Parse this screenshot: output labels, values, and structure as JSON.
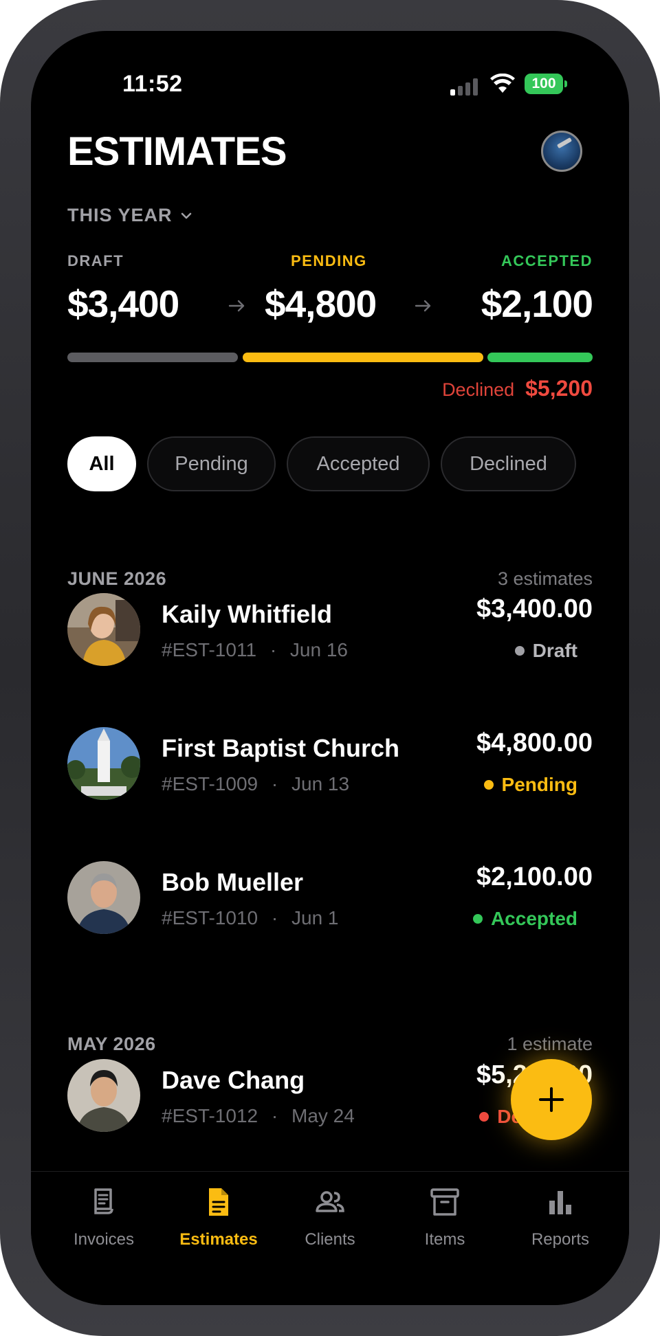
{
  "status_bar": {
    "time": "11:52",
    "battery": "100"
  },
  "header": {
    "title": "ESTIMATES",
    "period": "THIS YEAR"
  },
  "summary": {
    "draft": {
      "label": "DRAFT",
      "value": "$3,400"
    },
    "pending": {
      "label": "PENDING",
      "value": "$4,800"
    },
    "accepted": {
      "label": "ACCEPTED",
      "value": "$2,100"
    },
    "declined_label": "Declined",
    "declined_value": "$5,200"
  },
  "filters": [
    {
      "label": "All",
      "active": true
    },
    {
      "label": "Pending",
      "active": false
    },
    {
      "label": "Accepted",
      "active": false
    },
    {
      "label": "Declined",
      "active": false
    }
  ],
  "groups": [
    {
      "title": "JUNE 2026",
      "count": "3 estimates",
      "rows": [
        {
          "name": "Kaily Whitfield",
          "number": "#EST-1011",
          "date": "Jun 16",
          "amount": "$3,400.00",
          "status": "Draft"
        },
        {
          "name": "First Baptist Church",
          "number": "#EST-1009",
          "date": "Jun 13",
          "amount": "$4,800.00",
          "status": "Pending"
        },
        {
          "name": "Bob Mueller",
          "number": "#EST-1010",
          "date": "Jun 1",
          "amount": "$2,100.00",
          "status": "Accepted"
        }
      ]
    },
    {
      "title": "MAY 2026",
      "count": "1 estimate",
      "rows": [
        {
          "name": "Dave Chang",
          "number": "#EST-1012",
          "date": "May 24",
          "amount": "$5,200.00",
          "status": "Declined"
        }
      ]
    }
  ],
  "meta_separator": "·",
  "tabs": [
    {
      "label": "Invoices",
      "icon": "invoice-icon",
      "active": false
    },
    {
      "label": "Estimates",
      "icon": "document-icon",
      "active": true
    },
    {
      "label": "Clients",
      "icon": "people-icon",
      "active": false
    },
    {
      "label": "Items",
      "icon": "archive-box-icon",
      "active": false
    },
    {
      "label": "Reports",
      "icon": "bar-chart-icon",
      "active": false
    }
  ],
  "colors": {
    "accent": "#fbbc12",
    "draft": "#6e6e73",
    "pending": "#fbbc12",
    "accepted": "#34c759",
    "declined": "#ef4a3f"
  }
}
